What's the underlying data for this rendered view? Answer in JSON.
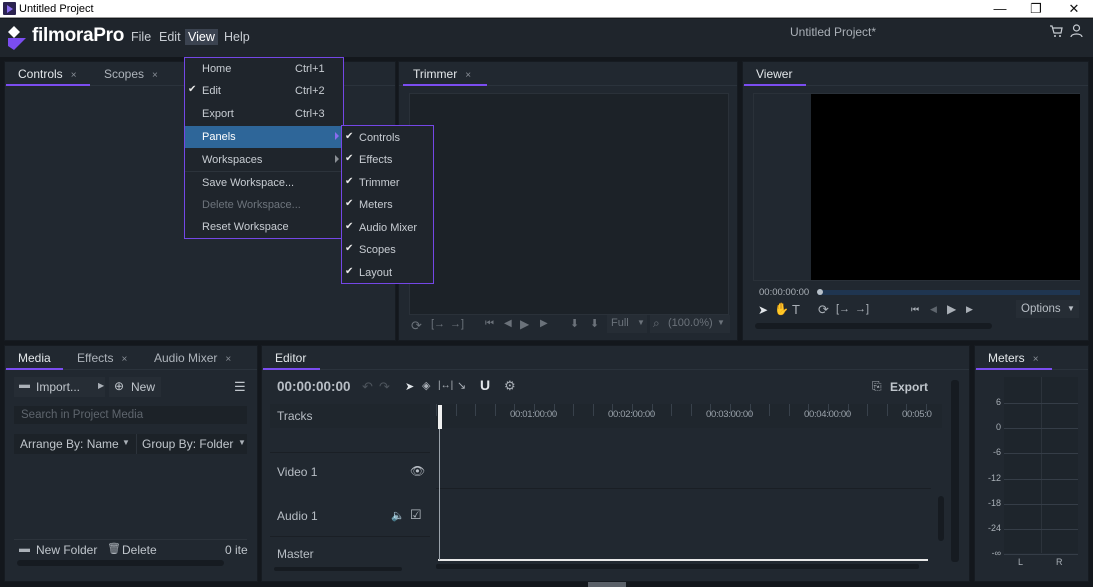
{
  "window": {
    "title": "Untitled Project",
    "controls": {
      "minimize": "—",
      "maximize": "❐",
      "close": "✕"
    }
  },
  "app": {
    "logo_text": "filmoraPro",
    "project_title": "Untitled Project*",
    "menu": [
      {
        "label": "File"
      },
      {
        "label": "Edit"
      },
      {
        "label": "View",
        "active": true
      },
      {
        "label": "Help"
      }
    ],
    "icons": {
      "cart": "cart-icon",
      "user": "user-icon"
    }
  },
  "view_menu": {
    "items": [
      {
        "label": "Home",
        "shortcut": "Ctrl+1",
        "checked": false
      },
      {
        "label": "Edit",
        "shortcut": "Ctrl+2",
        "checked": true
      },
      {
        "label": "Export",
        "shortcut": "Ctrl+3",
        "checked": false
      },
      {
        "label": "Panels",
        "submenu": true,
        "highlighted": true
      },
      {
        "label": "Workspaces",
        "submenu": true
      },
      {
        "label": "Save Workspace..."
      },
      {
        "label": "Delete Workspace...",
        "disabled": true
      },
      {
        "label": "Reset Workspace"
      }
    ],
    "check_glyph": "✔"
  },
  "panels_submenu": {
    "items": [
      {
        "label": "Controls",
        "checked": true
      },
      {
        "label": "Effects",
        "checked": true
      },
      {
        "label": "Trimmer",
        "checked": true
      },
      {
        "label": "Meters",
        "checked": true
      },
      {
        "label": "Audio Mixer",
        "checked": true
      },
      {
        "label": "Scopes",
        "checked": true
      },
      {
        "label": "Layout",
        "checked": true
      }
    ]
  },
  "top_left_panel": {
    "tabs": [
      {
        "label": "Controls",
        "active": true,
        "close": "×"
      },
      {
        "label": "Scopes",
        "active": false,
        "close": "×"
      }
    ]
  },
  "trimmer": {
    "tab": {
      "label": "Trimmer",
      "close": "×"
    },
    "quality": "Full",
    "zoom": "(100.0%)"
  },
  "viewer": {
    "tab": {
      "label": "Viewer"
    },
    "timecode": "00:00:00:00",
    "options_label": "Options"
  },
  "media_panel": {
    "tabs": [
      {
        "label": "Media",
        "active": true
      },
      {
        "label": "Effects",
        "close": "×"
      },
      {
        "label": "Audio Mixer",
        "close": "×"
      }
    ],
    "import_label": "Import...",
    "new_label": "New",
    "search_placeholder": "Search in Project Media",
    "arrange_by": "Arrange By: Name",
    "group_by": "Group By: Folder",
    "new_folder_label": "New Folder",
    "delete_label": "Delete",
    "item_count": "0 ite"
  },
  "editor": {
    "tab": {
      "label": "Editor"
    },
    "timecode": "00:00:00:00",
    "export_label": "Export",
    "tracks_header": "Tracks",
    "tracks": [
      {
        "name": "Video 1",
        "type": "video"
      },
      {
        "name": "Audio 1",
        "type": "audio"
      },
      {
        "name": "Master",
        "type": "master"
      }
    ],
    "ruler_labels": [
      "00:01:00:00",
      "00:02:00:00",
      "00:03:00:00",
      "00:04:00:00",
      "00:05:0"
    ]
  },
  "meters": {
    "tab": {
      "label": "Meters",
      "close": "×"
    },
    "scale": [
      "6",
      "0",
      "-6",
      "-12",
      "-18",
      "-24",
      "-∞"
    ],
    "channels": [
      "L",
      "R"
    ]
  }
}
